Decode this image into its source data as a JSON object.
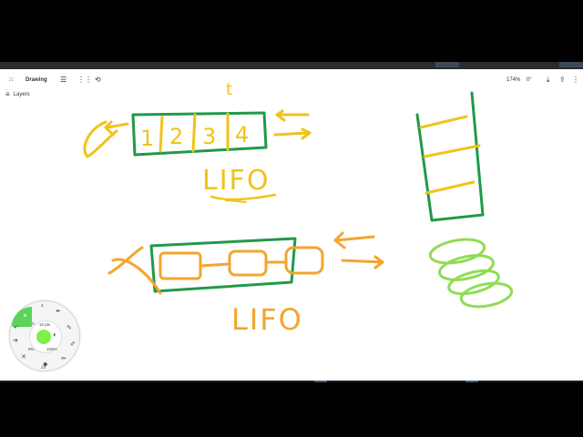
{
  "toolbar": {
    "grid_icon": "grid-icon",
    "title": "Drawing",
    "menu_icon": "menu-icon",
    "apps_icon": "apps-icon",
    "shapes_icon": "shapes-icon",
    "zoom": "174%",
    "rotation": "0°"
  },
  "layers": {
    "label": "Layers"
  },
  "canvas": {
    "handwriting": {
      "t": "t",
      "box1": "1",
      "box2": "2",
      "box3": "3",
      "box4": "4",
      "lifo_top": "LIFO",
      "lifo_bottom": "LIFO"
    }
  },
  "dial": {
    "size_label": "10 pts",
    "opacity_min": "0%",
    "opacity_max": "100%",
    "top_value": "4",
    "bottom_value": "24",
    "left_value": "N"
  },
  "colors": {
    "green_ink": "#1f9a48",
    "yellow_ink": "#f0c31a",
    "orange_ink": "#f2a62e",
    "lime_ink": "#8fdc55",
    "brush": "#7ff04a"
  }
}
